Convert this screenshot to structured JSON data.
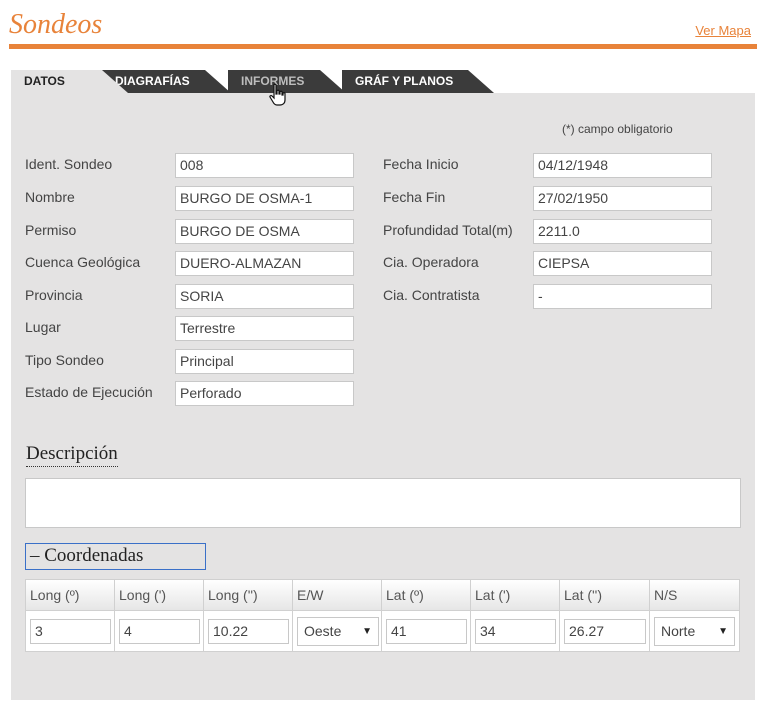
{
  "header": {
    "title": "Sondeos",
    "map_link": "Ver Mapa"
  },
  "tabs": [
    {
      "label": "DATOS",
      "active": true
    },
    {
      "label": "DIAGRAFÍAS",
      "active": false
    },
    {
      "label": "INFORMES",
      "active": false
    },
    {
      "label": "GRÁF Y PLANOS",
      "active": false
    }
  ],
  "form": {
    "required_note": "(*) campo obligatorio",
    "left": [
      {
        "label": "Ident. Sondeo",
        "value": "008"
      },
      {
        "label": "Nombre",
        "value": "BURGO DE OSMA-1"
      },
      {
        "label": "Permiso",
        "value": "BURGO DE OSMA"
      },
      {
        "label": "Cuenca Geológica",
        "value": "DUERO-ALMAZAN"
      },
      {
        "label": "Provincia",
        "value": "SORIA"
      },
      {
        "label": "Lugar",
        "value": "Terrestre"
      },
      {
        "label": "Tipo Sondeo",
        "value": "Principal"
      },
      {
        "label": "Estado de Ejecución",
        "value": "Perforado"
      }
    ],
    "right": [
      {
        "label": "Fecha Inicio",
        "value": "04/12/1948"
      },
      {
        "label": "Fecha Fin",
        "value": "27/02/1950"
      },
      {
        "label": "Profundidad Total(m)",
        "value": "2211.0"
      },
      {
        "label": "Cia. Operadora",
        "value": "CIEPSA"
      },
      {
        "label": "Cia. Contratista",
        "value": "-"
      }
    ]
  },
  "description": {
    "title": "Descripción",
    "value": ""
  },
  "coordinates": {
    "toggle_label": "– Coordenadas",
    "headers": [
      "Long (º)",
      "Long (')",
      "Long ('')",
      "E/W",
      "Lat (º)",
      "Lat (')",
      "Lat ('')",
      "N/S"
    ],
    "values": {
      "long_deg": "3",
      "long_min": "4",
      "long_sec": "10.22",
      "ew": "Oeste",
      "lat_deg": "41",
      "lat_min": "34",
      "lat_sec": "26.27",
      "ns": "Norte"
    }
  },
  "colors": {
    "accent": "#e8833a",
    "tab_dark": "#3b3b3b",
    "panel_bg": "#e4e3e3"
  }
}
